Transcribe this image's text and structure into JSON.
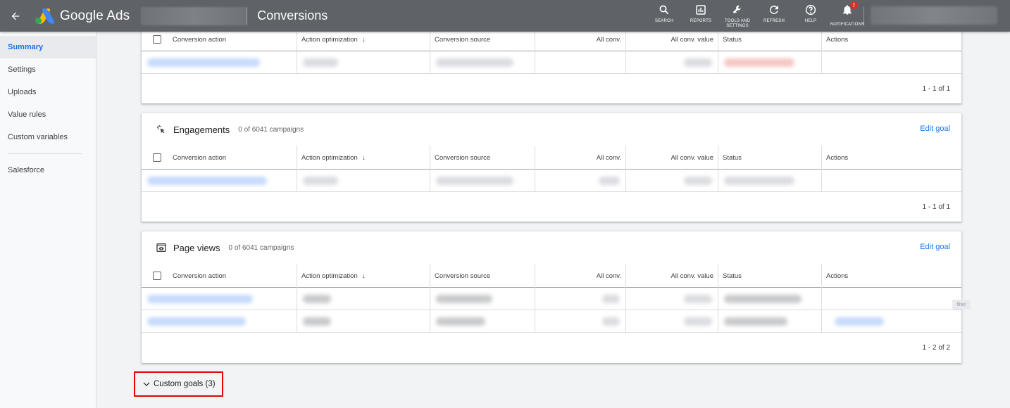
{
  "app": {
    "name": "Google Ads",
    "page_title": "Conversions"
  },
  "toolbar": [
    {
      "label": "SEARCH",
      "icon": "search-icon"
    },
    {
      "label": "REPORTS",
      "icon": "reports-icon"
    },
    {
      "label": "TOOLS AND SETTINGS",
      "icon": "wrench-icon"
    },
    {
      "label": "REFRESH",
      "icon": "refresh-icon"
    },
    {
      "label": "HELP",
      "icon": "help-icon"
    },
    {
      "label": "NOTIFICATIONS",
      "icon": "bell-icon",
      "badge": "!"
    }
  ],
  "sidebar": {
    "items": [
      {
        "label": "Summary",
        "active": true
      },
      {
        "label": "Settings"
      },
      {
        "label": "Uploads"
      },
      {
        "label": "Value rules"
      },
      {
        "label": "Custom variables"
      }
    ],
    "secondary": [
      {
        "label": "Salesforce"
      }
    ]
  },
  "columns": [
    "Conversion action",
    "Action optimization",
    "Conversion source",
    "All conv.",
    "All conv. value",
    "Status",
    "Actions"
  ],
  "cards": [
    {
      "title": "",
      "subtitle": "",
      "edit": "",
      "pagination": "1 - 1 of 1"
    },
    {
      "title": "Engagements",
      "subtitle": "0 of 6041 campaigns",
      "edit": "Edit goal",
      "pagination": "1 - 1 of 1"
    },
    {
      "title": "Page views",
      "subtitle": "0 of 6041 campaigns",
      "edit": "Edit goal",
      "pagination": "1 - 2 of 2"
    }
  ],
  "filter_chip": "filter",
  "custom_goals": {
    "label": "Custom goals (3)",
    "expanded": true
  },
  "colors": {
    "topbar": "#5f6368",
    "accent": "#1a73e8",
    "highlight_box": "#e10600"
  }
}
